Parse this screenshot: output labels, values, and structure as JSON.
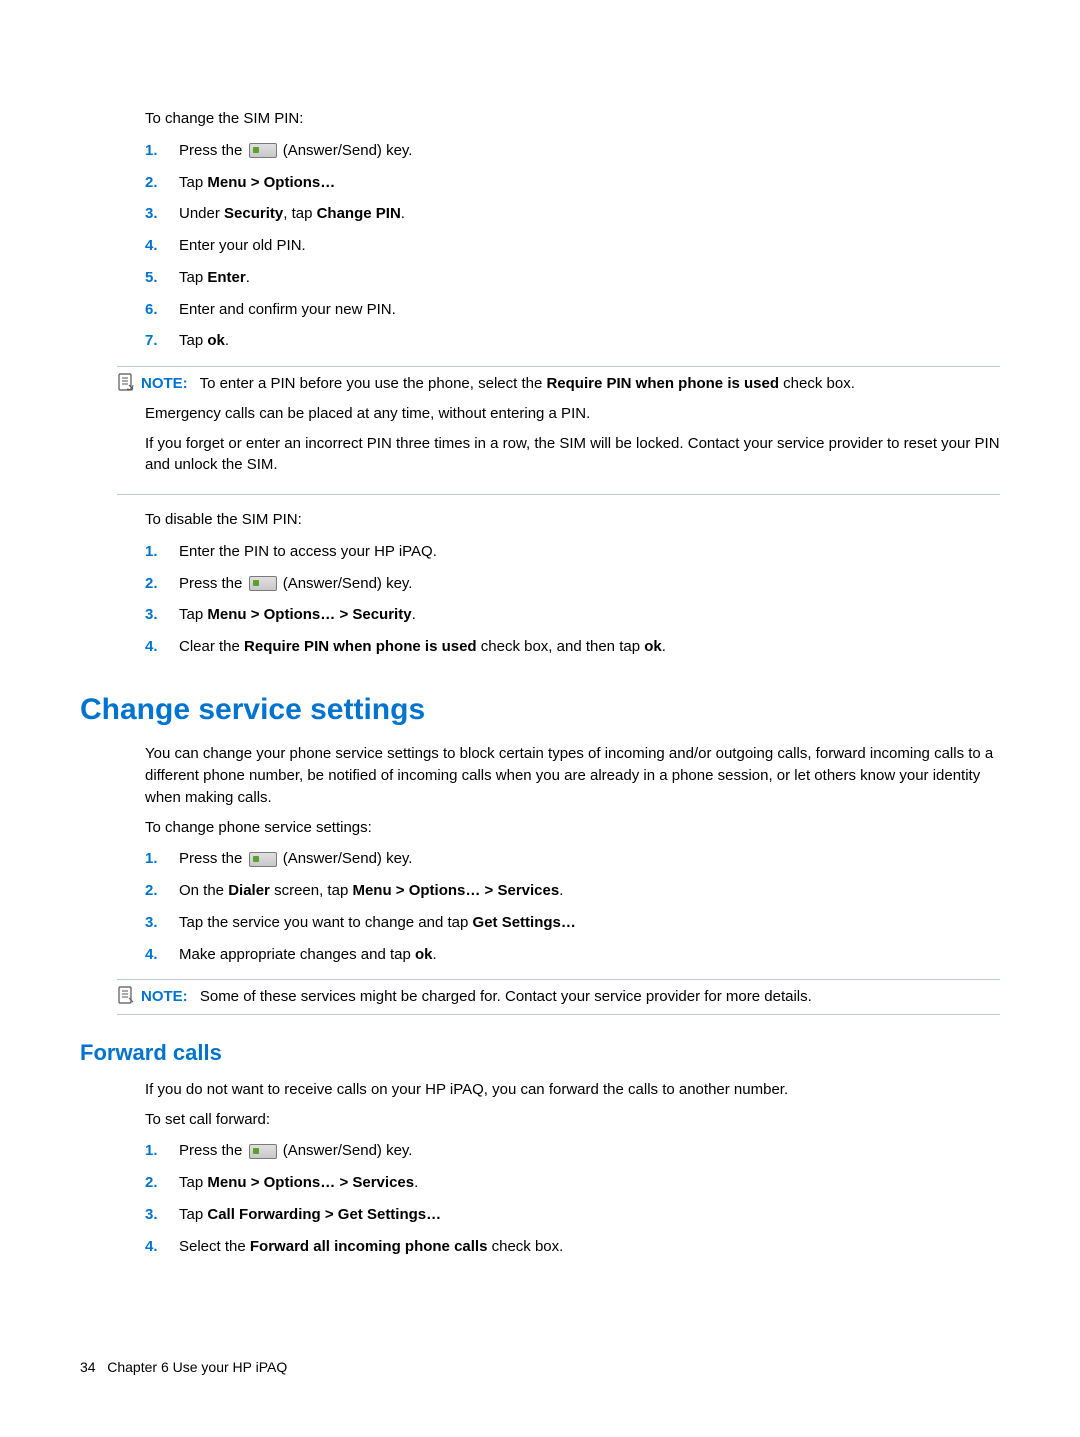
{
  "sec1": {
    "intro": "To change the SIM PIN:",
    "steps": [
      {
        "num": "1.",
        "pre": "Press the ",
        "post": " (Answer/Send) key.",
        "icon": true
      },
      {
        "num": "2.",
        "pre": "Tap ",
        "b1": "Menu > Options…",
        "post": ""
      },
      {
        "num": "3.",
        "pre": "Under ",
        "b1": "Security",
        "mid": ", tap ",
        "b2": "Change PIN",
        "post": "."
      },
      {
        "num": "4.",
        "pre": "Enter your old PIN."
      },
      {
        "num": "5.",
        "pre": "Tap ",
        "b1": "Enter",
        "post": "."
      },
      {
        "num": "6.",
        "pre": "Enter and confirm your new PIN."
      },
      {
        "num": "7.",
        "pre": "Tap ",
        "b1": "ok",
        "post": "."
      }
    ],
    "note": {
      "label": "NOTE:",
      "line1_pre": "To enter a PIN before you use the phone, select the ",
      "line1_bold": "Require PIN when phone is used",
      "line1_post": " check box.",
      "p2": "Emergency calls can be placed at any time, without entering a PIN.",
      "p3": "If you forget or enter an incorrect PIN three times in a row, the SIM will be locked. Contact your service provider to reset your PIN and unlock the SIM."
    },
    "disable_intro": "To disable the SIM PIN:",
    "disable_steps": [
      {
        "num": "1.",
        "pre": "Enter the PIN to access your HP iPAQ."
      },
      {
        "num": "2.",
        "pre": "Press the ",
        "post": " (Answer/Send) key.",
        "icon": true
      },
      {
        "num": "3.",
        "pre": "Tap ",
        "b1": "Menu > Options… > Security",
        "post": "."
      },
      {
        "num": "4.",
        "pre": "Clear the ",
        "b1": "Require PIN when phone is used",
        "mid": " check box, and then tap ",
        "b2": "ok",
        "post": "."
      }
    ]
  },
  "sec2": {
    "heading": "Change service settings",
    "intro": "You can change your phone service settings to block certain types of incoming and/or outgoing calls, forward incoming calls to a different phone number, be notified of incoming calls when you are already in a phone session, or let others know your identity when making calls.",
    "intro2": "To change phone service settings:",
    "steps": [
      {
        "num": "1.",
        "pre": "Press the ",
        "post": " (Answer/Send) key.",
        "icon": true
      },
      {
        "num": "2.",
        "pre": "On the ",
        "b1": "Dialer",
        "mid": " screen, tap ",
        "b2": "Menu > Options… > Services",
        "post": "."
      },
      {
        "num": "3.",
        "pre": "Tap the service you want to change and tap ",
        "b1": "Get Settings…"
      },
      {
        "num": "4.",
        "pre": "Make appropriate changes and tap ",
        "b1": "ok",
        "post": "."
      }
    ],
    "note": {
      "label": "NOTE:",
      "text": "Some of these services might be charged for. Contact your service provider for more details."
    }
  },
  "sec3": {
    "heading": "Forward calls",
    "intro": "If you do not want to receive calls on your HP iPAQ, you can forward the calls to another number.",
    "intro2": "To set call forward:",
    "steps": [
      {
        "num": "1.",
        "pre": "Press the ",
        "post": " (Answer/Send) key.",
        "icon": true
      },
      {
        "num": "2.",
        "pre": "Tap ",
        "b1": "Menu > Options… > Services",
        "post": "."
      },
      {
        "num": "3.",
        "pre": "Tap ",
        "b1": "Call Forwarding > Get Settings…"
      },
      {
        "num": "4.",
        "pre": "Select the ",
        "b1": "Forward all incoming phone calls",
        "post": " check box."
      }
    ]
  },
  "footer": {
    "page": "34",
    "chapter": "Chapter 6   Use your HP iPAQ"
  }
}
